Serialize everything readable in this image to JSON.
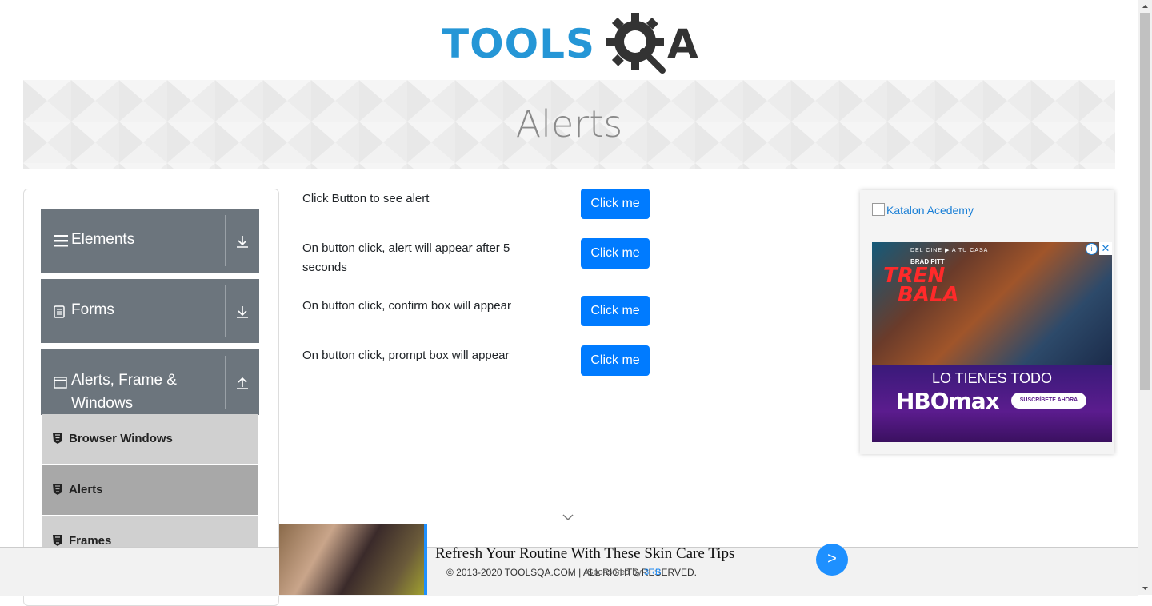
{
  "header": {
    "logo_text": "TOOLS",
    "logo_suffix": "A"
  },
  "banner": {
    "title": "Alerts"
  },
  "sidebar": {
    "groups": [
      {
        "label": "Elements",
        "icon": "hamburger-icon",
        "arrow": "download-icon"
      },
      {
        "label": "Forms",
        "icon": "document-icon",
        "arrow": "download-icon"
      },
      {
        "label": "Alerts, Frame &",
        "label2": "Windows",
        "icon": "window-icon",
        "arrow": "upload-icon"
      }
    ],
    "items": [
      {
        "label": "Browser Windows"
      },
      {
        "label": "Alerts"
      },
      {
        "label": "Frames"
      }
    ]
  },
  "main": {
    "rows": [
      {
        "label": "Click Button to see alert",
        "button": "Click me"
      },
      {
        "label": "On button click, alert will appear after 5 seconds",
        "button": "Click me"
      },
      {
        "label": "On button click, confirm box will appear",
        "button": "Click me"
      },
      {
        "label": "On button click, prompt box will appear",
        "button": "Click me"
      }
    ]
  },
  "right_ad": {
    "link_text": "Katalon Acedemy",
    "tagline": "DEL CINE ▶ A TU CASA",
    "actor": "BRAD PITT",
    "title_line1": "TREN",
    "title_line2": "BALA",
    "slogan": "LO TIENES TODO",
    "brand": "HBOmax",
    "cta": "SUSCRÍBETE AHORA",
    "close": "✕",
    "info": "i"
  },
  "bottom_ad": {
    "title": "Refresh Your Routine With These Skin Care Tips",
    "sponsored": "Sponsored by",
    "sponsor": "3RB",
    "go": ">"
  },
  "footer": {
    "text": "© 2013-2020 TOOLSQA.COM | ALL RIGHTS RESERVED."
  },
  "colors": {
    "primary": "#007bff",
    "sidebar_group": "#6c757d",
    "logo_blue": "#2596d6"
  }
}
